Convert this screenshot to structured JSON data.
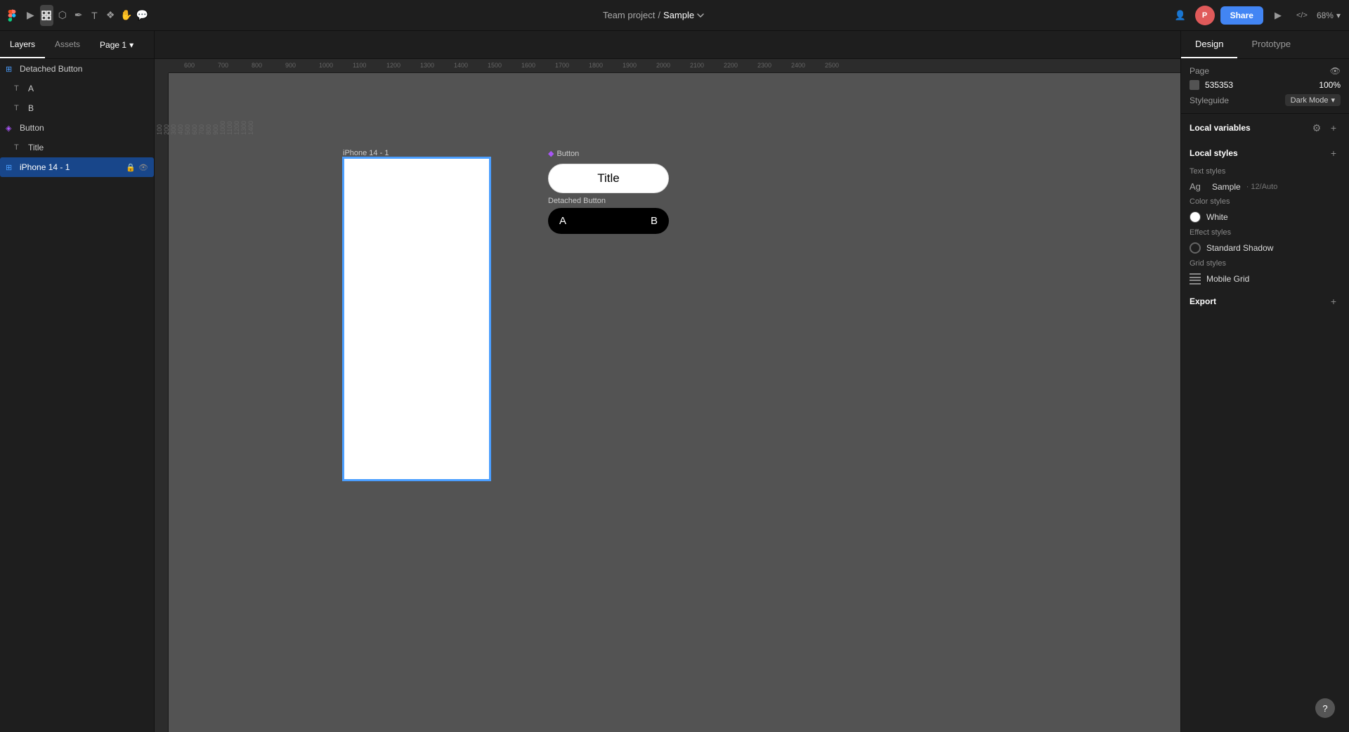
{
  "app": {
    "logo": "F",
    "logo_color": "#f24e1e"
  },
  "toolbar": {
    "tools": [
      {
        "id": "select",
        "icon": "▶",
        "label": "Select tool",
        "active": false
      },
      {
        "id": "move",
        "icon": "✦",
        "label": "Move tool",
        "active": true
      },
      {
        "id": "frame",
        "icon": "⊞",
        "label": "Frame tool",
        "active": false
      },
      {
        "id": "shape",
        "icon": "⬠",
        "label": "Shape tool",
        "active": false
      },
      {
        "id": "pen",
        "icon": "✒",
        "label": "Pen tool",
        "active": false
      },
      {
        "id": "text",
        "icon": "T",
        "label": "Text tool",
        "active": false
      },
      {
        "id": "component",
        "icon": "❖",
        "label": "Component tool",
        "active": false
      },
      {
        "id": "hand",
        "icon": "✋",
        "label": "Hand tool",
        "active": false
      },
      {
        "id": "comment",
        "icon": "💬",
        "label": "Comment tool",
        "active": false
      }
    ],
    "project_team": "Team project",
    "project_separator": "/",
    "project_name": "Sample",
    "share_label": "Share",
    "present_icon": "▶",
    "zoom_level": "68%",
    "zoom_chevron": "▾",
    "user_avatar": "P",
    "multiplayer_icon": "👤"
  },
  "secondary_bar": {
    "left_tabs": [
      {
        "id": "layers",
        "label": "Layers",
        "active": true
      },
      {
        "id": "assets",
        "label": "Assets",
        "active": false
      }
    ],
    "page_label": "Page 1",
    "right_tabs": [
      {
        "id": "design",
        "label": "Design",
        "active": true
      },
      {
        "id": "prototype",
        "label": "Prototype",
        "active": false
      }
    ]
  },
  "layers_panel": {
    "items": [
      {
        "id": "detached-button",
        "label": "Detached Button",
        "icon": "⊞",
        "indent": 0,
        "type": "frame"
      },
      {
        "id": "a-text",
        "label": "A",
        "icon": "T",
        "indent": 1,
        "type": "text"
      },
      {
        "id": "b-text",
        "label": "B",
        "icon": "T",
        "indent": 1,
        "type": "text"
      },
      {
        "id": "button-component",
        "label": "Button",
        "icon": "◈",
        "indent": 0,
        "type": "component"
      },
      {
        "id": "title-text",
        "label": "Title",
        "icon": "T",
        "indent": 1,
        "type": "text"
      },
      {
        "id": "iphone-frame",
        "label": "iPhone 14 - 1",
        "icon": "⊞",
        "indent": 0,
        "type": "frame",
        "selected": true
      }
    ]
  },
  "canvas": {
    "iphone_label": "iPhone 14 - 1",
    "button_label": "Button",
    "detached_button_label": "Detached Button",
    "canvas_button_title": "Title",
    "canvas_button_a": "A",
    "canvas_button_b": "B",
    "bg_color": "#535353"
  },
  "ruler": {
    "h_ticks": [
      "600",
      "700",
      "800",
      "900",
      "1000",
      "1100",
      "1200",
      "1300",
      "1400",
      "1500",
      "1600",
      "1700",
      "1800",
      "1900",
      "2000",
      "2100",
      "2200",
      "2300",
      "2400",
      "2500"
    ],
    "v_ticks": [
      "100",
      "200",
      "300",
      "400",
      "500",
      "600",
      "700",
      "800",
      "900",
      "1000",
      "1100",
      "1200",
      "1300",
      "1400"
    ]
  },
  "right_panel": {
    "page_section": {
      "title": "Page",
      "bg_color": "#535353",
      "bg_color_display": "535353",
      "opacity": "100%",
      "styleguide_label": "Styleguide",
      "dark_mode_label": "Dark Mode",
      "eye_icon": "👁"
    },
    "local_variables": {
      "title": "Local variables"
    },
    "local_styles": {
      "title": "Local styles",
      "text_styles_title": "Text styles",
      "text_styles": [
        {
          "ag": "Ag",
          "name": "Sample",
          "meta": "12/Auto"
        }
      ],
      "color_styles_title": "Color styles",
      "color_styles": [
        {
          "name": "White",
          "color": "#ffffff"
        }
      ],
      "effect_styles_title": "Effect styles",
      "effect_styles": [
        {
          "name": "Standard Shadow"
        }
      ],
      "grid_styles_title": "Grid styles",
      "grid_styles": [
        {
          "name": "Mobile Grid"
        }
      ]
    },
    "export": {
      "title": "Export"
    }
  }
}
